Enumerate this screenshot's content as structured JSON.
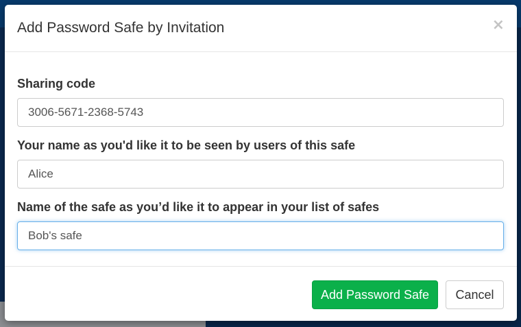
{
  "modal": {
    "title": "Add Password Safe by Invitation",
    "close_symbol": "×"
  },
  "form": {
    "sharing_code": {
      "label": "Sharing code",
      "value": "3006-5671-2368-5743"
    },
    "your_name": {
      "label": "Your name as you'd like it to be seen by users of this safe",
      "value": "Alice"
    },
    "safe_name": {
      "label": "Name of the safe as you’d like it to appear in your list of safes",
      "value": "Bob's safe"
    }
  },
  "footer": {
    "add_label": "Add Password Safe",
    "cancel_label": "Cancel"
  },
  "colors": {
    "primary_button": "#0bb04a",
    "focus_border": "#66afe9",
    "backdrop_app": "#0b5aa6"
  }
}
